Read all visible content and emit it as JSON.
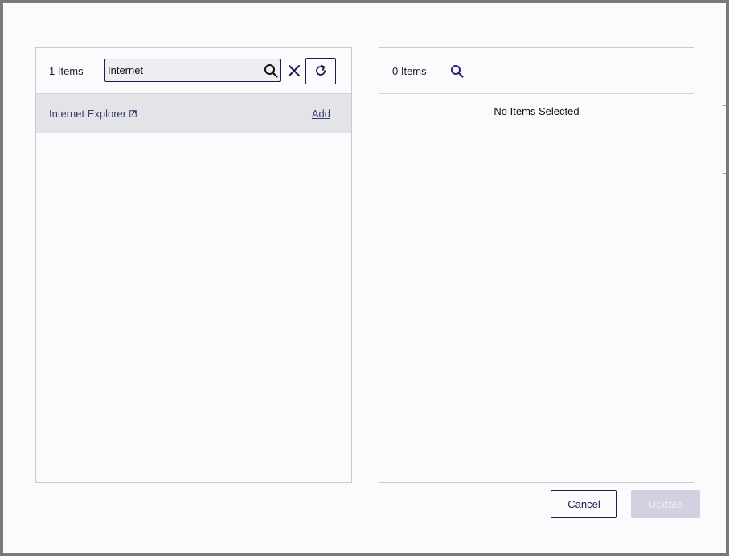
{
  "left_panel": {
    "count_label": "1 Items",
    "search": {
      "value": "Internet",
      "placeholder": ""
    },
    "results": [
      {
        "name": "Internet Explorer",
        "action_label": "Add"
      }
    ]
  },
  "right_panel": {
    "count_label": "0 Items",
    "empty_message": "No Items Selected"
  },
  "footer": {
    "cancel_label": "Cancel",
    "update_label": "Update"
  },
  "icons": {
    "search": "search-icon",
    "clear": "close-icon",
    "refresh": "refresh-icon",
    "external": "external-link-icon"
  },
  "colors": {
    "accent": "#1e1a4d",
    "link": "#3c3a6a",
    "row_bg": "#e3e4e8",
    "disabled_button": "#d2d1e1"
  }
}
